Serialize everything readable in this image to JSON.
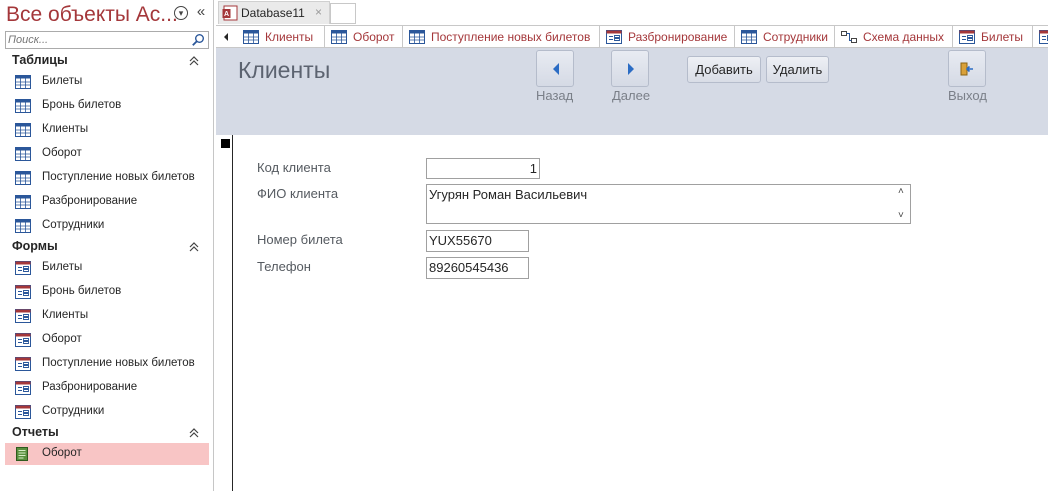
{
  "nav_pane": {
    "title": "Все объекты Ac...",
    "search_placeholder": "Поиск...",
    "groups": [
      {
        "label": "Таблицы",
        "items": [
          "Билеты",
          "Бронь билетов",
          "Клиенты",
          "Оборот",
          "Поступление новых билетов",
          "Разбронирование",
          "Сотрудники"
        ]
      },
      {
        "label": "Формы",
        "items": [
          "Билеты",
          "Бронь билетов",
          "Клиенты",
          "Оборот",
          "Поступление новых билетов",
          "Разбронирование",
          "Сотрудники"
        ]
      },
      {
        "label": "Отчеты",
        "items": [
          "Оборот"
        ]
      }
    ],
    "selected": "Отчеты/Оборот"
  },
  "db_tab": {
    "label": "Database11",
    "close": "×"
  },
  "object_tabs": [
    {
      "label": "Клиенты",
      "icon": "table-icon"
    },
    {
      "label": "Оборот",
      "icon": "table-icon"
    },
    {
      "label": "Поступление новых билетов",
      "icon": "table-icon"
    },
    {
      "label": "Разбронирование",
      "icon": "form-icon"
    },
    {
      "label": "Сотрудники",
      "icon": "table-icon"
    },
    {
      "label": "Схема данных",
      "icon": "relationships-icon"
    },
    {
      "label": "Билеты",
      "icon": "form-icon"
    }
  ],
  "form": {
    "title": "Клиенты",
    "back_label": "Назад",
    "next_label": "Далее",
    "add_label": "Добавить",
    "delete_label": "Удалить",
    "exit_label": "Выход",
    "fields": {
      "client_id": {
        "label": "Код клиента",
        "value": "1"
      },
      "full_name": {
        "label": "ФИО клиента",
        "value": "Угурян Роман Васильевич"
      },
      "ticket_no": {
        "label": "Номер билета",
        "value": "YUX55670"
      },
      "phone": {
        "label": "Телефон",
        "value": "89260545436"
      }
    }
  },
  "colors": {
    "accent": "#a4373a",
    "selected_item_bg": "#f8c5c5",
    "form_header_bg": "#d5dae5"
  }
}
